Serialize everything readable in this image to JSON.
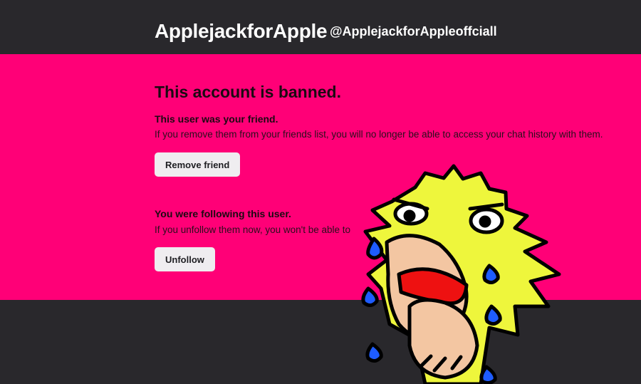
{
  "header": {
    "display_name": "ApplejackforApple",
    "handle": "@ApplejackforAppleoffciall"
  },
  "ban_notice": {
    "title": "This account is banned.",
    "friend_section": {
      "heading": "This user was your friend.",
      "text": "If you remove them from your friends list, you will no longer be able to access your chat history with them.",
      "button_label": "Remove friend"
    },
    "follow_section": {
      "heading": "You were following this user.",
      "text": "If you unfollow them now, you won't be able to",
      "button_label": "Unfollow"
    }
  },
  "overlay": {
    "icon": "crying-yellow-hedgehog-drawing"
  },
  "colors": {
    "banner": "#ff0077",
    "background": "#29282c",
    "button": "#efedf0",
    "character_yellow": "#eef63c",
    "tears": "#1e5cff"
  }
}
